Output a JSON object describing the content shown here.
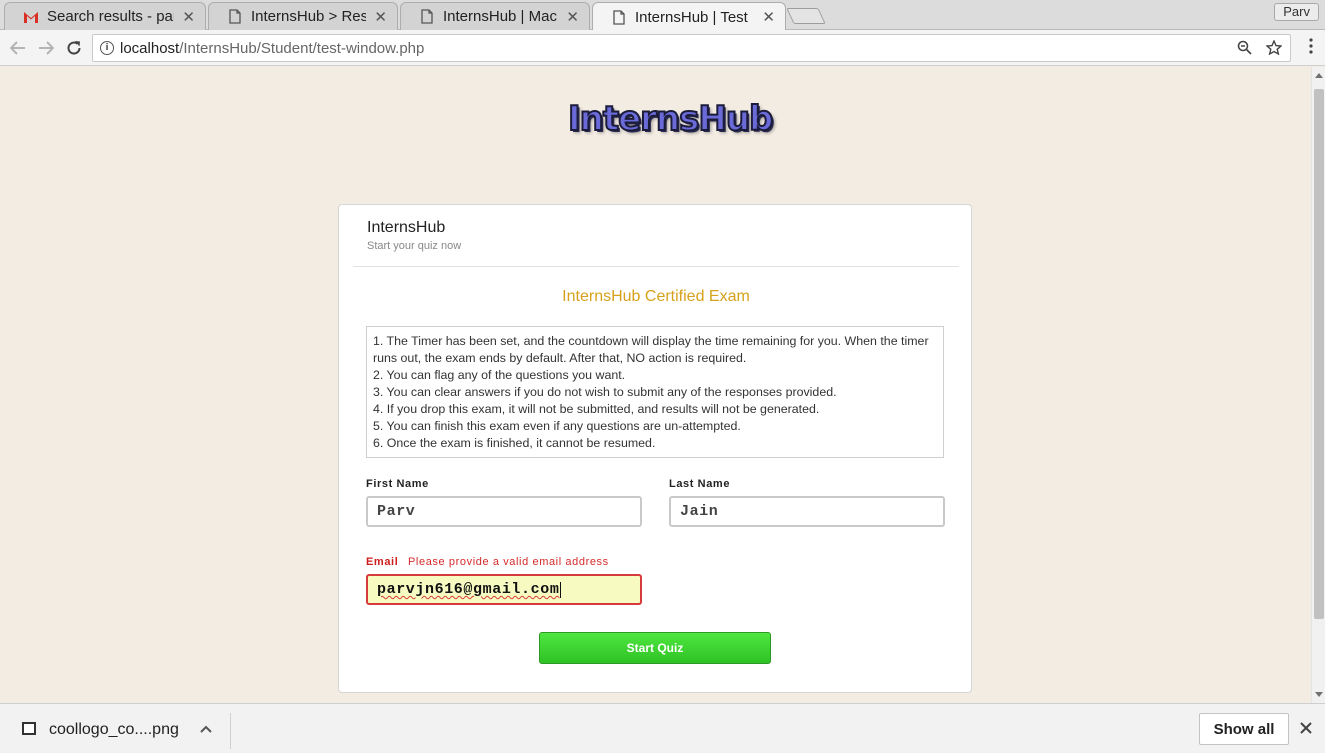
{
  "browser": {
    "tabs": [
      {
        "title": "Search results - parv",
        "favicon": "gmail-icon"
      },
      {
        "title": "InternsHub > Result",
        "favicon": "page-icon"
      },
      {
        "title": "InternsHub | Machi",
        "favicon": "page-icon"
      },
      {
        "title": "InternsHub | Test",
        "favicon": "page-icon",
        "active": true
      }
    ],
    "profile_name": "Parv",
    "url_host": "localhost",
    "url_path": "/InternsHub/Student/test-window.php"
  },
  "logo": {
    "text": "InternsHub"
  },
  "card": {
    "title": "InternsHub",
    "subtitle": "Start your quiz now",
    "exam_title": "InternsHub Certified Exam",
    "rules": [
      "1. The Timer has been set, and the countdown will display the time remaining for you. When the timer runs out, the exam ends by default. After that, NO action is required.",
      "2. You can flag any of the questions you want.",
      "3. You can clear answers if you do not wish to submit any of the responses provided.",
      "4. If you drop this exam, it will not be submitted, and results will not be generated.",
      "5. You can finish this exam even if any questions are un-attempted.",
      "6. Once the exam is finished, it cannot be resumed."
    ]
  },
  "form": {
    "first_name_label": "First Name",
    "first_name_value": "Parv",
    "last_name_label": "Last Name",
    "last_name_value": "Jain",
    "email_label": "Email",
    "email_error": "Please provide a valid email address",
    "email_value": "parvjn616@gmail.com",
    "submit_label": "Start Quiz"
  },
  "downloads": {
    "file_name": "coollogo_co....png",
    "show_all_label": "Show all"
  },
  "colors": {
    "page_bg": "#f3ece3",
    "exam_title": "#d6a21c",
    "error": "#cc1e1e",
    "button_green": "#3dd432"
  }
}
